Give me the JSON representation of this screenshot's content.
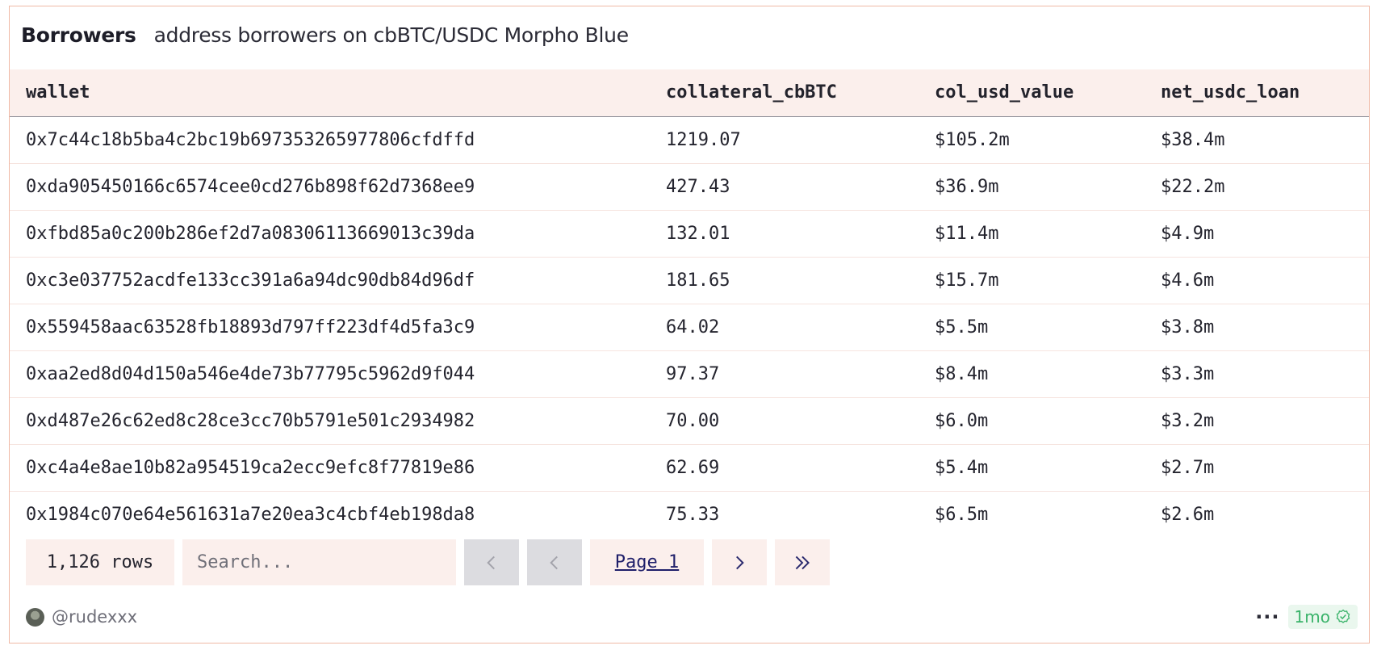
{
  "header": {
    "title": "Borrowers",
    "subtitle": "address borrowers on cbBTC/USDC Morpho Blue"
  },
  "table": {
    "columns": [
      "wallet",
      "collateral_cbBTC",
      "col_usd_value",
      "net_usdc_loan"
    ],
    "rows": [
      [
        "0x7c44c18b5ba4c2bc19b697353265977806cfdffd",
        "1219.07",
        "$105.2m",
        "$38.4m"
      ],
      [
        "0xda905450166c6574cee0cd276b898f62d7368ee9",
        "427.43",
        "$36.9m",
        "$22.2m"
      ],
      [
        "0xfbd85a0c200b286ef2d7a08306113669013c39da",
        "132.01",
        "$11.4m",
        "$4.9m"
      ],
      [
        "0xc3e037752acdfe133cc391a6a94dc90db84d96df",
        "181.65",
        "$15.7m",
        "$4.6m"
      ],
      [
        "0x559458aac63528fb18893d797ff223df4d5fa3c9",
        "64.02",
        "$5.5m",
        "$3.8m"
      ],
      [
        "0xaa2ed8d04d150a546e4de73b77795c5962d9f044",
        "97.37",
        "$8.4m",
        "$3.3m"
      ],
      [
        "0xd487e26c62ed8c28ce3cc70b5791e501c2934982",
        "70.00",
        "$6.0m",
        "$3.2m"
      ],
      [
        "0xc4a4e8ae10b82a954519ca2ecc9efc8f77819e86",
        "62.69",
        "$5.4m",
        "$2.7m"
      ],
      [
        "0x1984c070e64e561631a7e20ea3c4cbf4eb198da8",
        "75.33",
        "$6.5m",
        "$2.6m"
      ]
    ]
  },
  "controls": {
    "rows_count": "1,126 rows",
    "search_placeholder": "Search...",
    "page_label": "Page 1",
    "icons": [
      "first-page-icon",
      "prev-page-icon",
      "next-page-icon",
      "last-page-icon"
    ]
  },
  "footer": {
    "username": "@rudexxx",
    "more_label": "···",
    "age": "1mo",
    "age_icon": "verified-check-icon",
    "accent_color": "#3ab36a"
  }
}
